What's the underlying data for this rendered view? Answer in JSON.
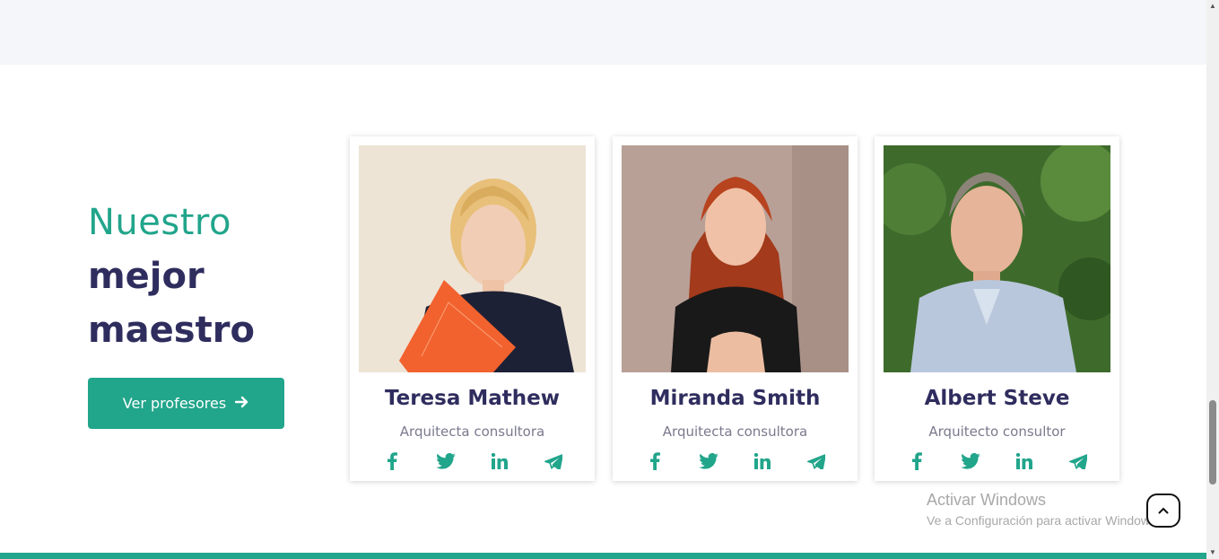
{
  "section": {
    "heading_line1": "Nuestro",
    "heading_line2": "mejor",
    "heading_line3": "maestro",
    "cta_label": "Ver profesores"
  },
  "teachers": [
    {
      "name": "Teresa Mathew",
      "role": "Arquitecta consultora",
      "socials": [
        "facebook-icon",
        "twitter-icon",
        "linkedin-icon",
        "telegram-icon"
      ]
    },
    {
      "name": "Miranda Smith",
      "role": "Arquitecta consultora",
      "socials": [
        "facebook-icon",
        "twitter-icon",
        "linkedin-icon",
        "telegram-icon"
      ]
    },
    {
      "name": "Albert Steve",
      "role": "Arquitecto consultor",
      "socials": [
        "facebook-icon",
        "twitter-icon",
        "linkedin-icon",
        "telegram-icon"
      ]
    }
  ],
  "watermark": {
    "title": "Activar Windows",
    "subtitle": "Ve a Configuración para activar Windows."
  },
  "colors": {
    "accent": "#21a58b",
    "heading": "#2f2d5e",
    "muted": "#7a7a8e"
  }
}
